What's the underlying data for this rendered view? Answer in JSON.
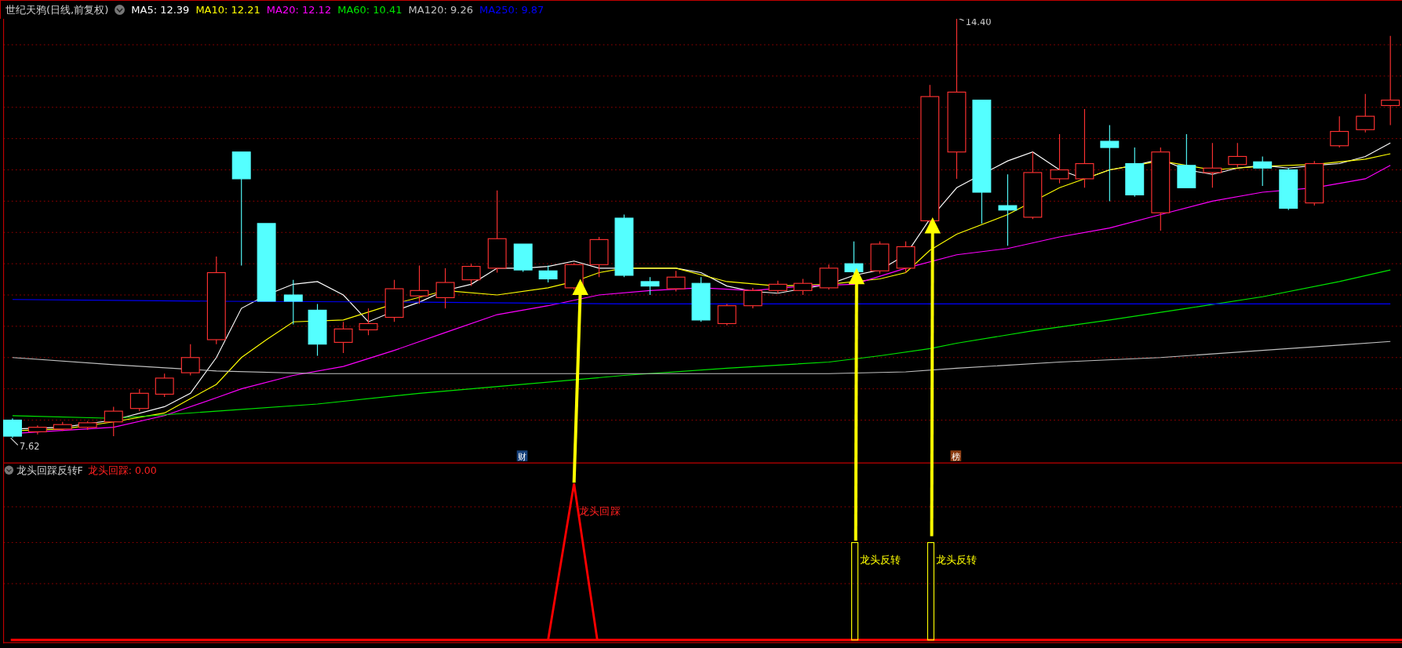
{
  "chart_header": {
    "title": "世纪天鸦(日线,前复权)",
    "moving_averages": [
      {
        "label": "MA5: 12.39",
        "color": "#ffffff"
      },
      {
        "label": "MA10: 12.21",
        "color": "#ffff00"
      },
      {
        "label": "MA20: 12.12",
        "color": "#ff00ff"
      },
      {
        "label": "MA60: 10.41",
        "color": "#00e600"
      },
      {
        "label": "MA120: 9.26",
        "color": "#c0c0c0"
      },
      {
        "label": "MA250: 9.87",
        "color": "#0000ff"
      }
    ]
  },
  "price_chart": {
    "high_label": "14.40",
    "low_label": "7.62",
    "markers": [
      {
        "label": "财",
        "color": "#16407a"
      },
      {
        "label": "榜",
        "color": "#8a3c12"
      }
    ]
  },
  "indicator_header": {
    "name": "龙头回踩反转F",
    "readout": "龙头回踩: 0.00"
  },
  "signals": [
    {
      "kind": "pullback",
      "label": "龙头回踩"
    },
    {
      "kind": "reversal",
      "label": "龙头反转"
    },
    {
      "kind": "reversal",
      "label": "龙头反转"
    }
  ]
}
